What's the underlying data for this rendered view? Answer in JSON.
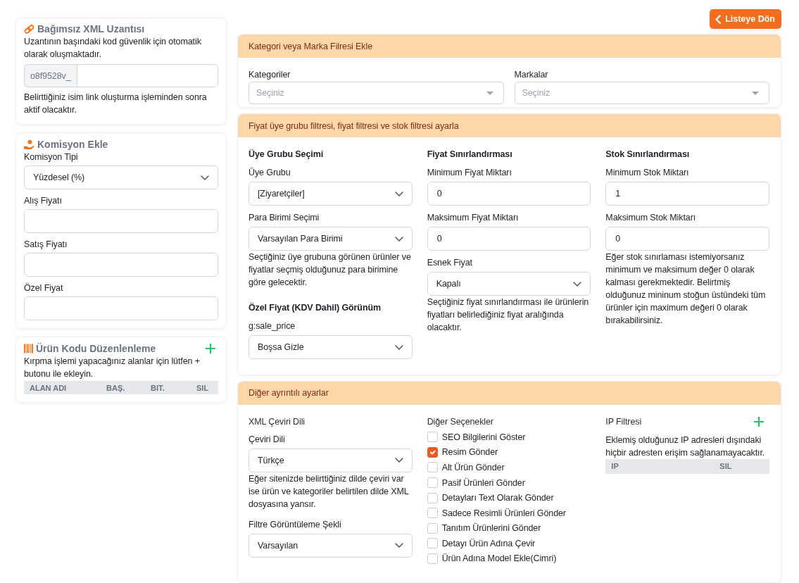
{
  "sidebar": [
    {
      "kind": "xml_extension",
      "title": "Bağımsız XML Uzantısı",
      "description": "Uzantının başındaki kod güvenlik için otomatik olarak oluşmaktadır.",
      "prefix": "o8f9528v_",
      "note": "Belirttiğiniz isim link oluşturma işleminden sonra aktif olacaktır."
    },
    {
      "kind": "commission",
      "title": "Komisyon Ekle",
      "fields": [
        {
          "kind": "select",
          "label": "Komisyon Tipi",
          "value": "Yüzdesel (%)"
        },
        {
          "kind": "input",
          "label": "Alış Fiyatı"
        },
        {
          "kind": "input",
          "label": "Satış Fiyatı"
        },
        {
          "kind": "input",
          "label": "Özel Fiyat"
        }
      ]
    },
    {
      "kind": "product_code",
      "title": "Ürün Kodu Düzenlenleme",
      "add_button": true,
      "description": "Kırpma işlemi yapacağınız alanlar için lütfen + butonu ile ekleyin.",
      "columns": [
        "ALAN ADI",
        "BAŞ.",
        "BIT.",
        "SIL"
      ]
    }
  ],
  "back_button": {
    "label": "Listeye Dön"
  },
  "sections": [
    {
      "title": "Kategori veya Marka Filresi Ekle",
      "columns": [
        {
          "items": [
            {
              "kind": "combo",
              "label": "Kategoriler",
              "placeholder": "Seçiniz"
            }
          ]
        },
        {
          "items": [
            {
              "kind": "combo",
              "label": "Markalar",
              "placeholder": "Seçiniz"
            }
          ]
        }
      ]
    },
    {
      "title": "Fiyat üye grubu filtresi, fiyat filtresi ve stok filtresi ayarla",
      "columns": [
        {
          "items": [
            {
              "kind": "heading",
              "text": "Üye Grubu Seçimi"
            },
            {
              "kind": "select",
              "label": "Üye Grubu",
              "value": "[Ziyaretçiler]"
            },
            {
              "kind": "select",
              "label": "Para Birimi Seçimi",
              "value": "Varsayılan Para Birimi"
            },
            {
              "kind": "help",
              "text": "Seçtiğiniz üye grubuna görünen ürünler ve fiyatlar seçmiş olduğunuz para birimine göre gelecektir."
            },
            {
              "kind": "heading",
              "text": "Özel Fiyat (KDV Dahil) Görünüm"
            },
            {
              "kind": "select",
              "label": "g:sale_price",
              "value": "Boşsa Gizle"
            }
          ]
        },
        {
          "items": [
            {
              "kind": "heading",
              "text": "Fiyat Sınırlandırması"
            },
            {
              "kind": "input",
              "label": "Minimum Fiyat Miktarı",
              "value": "0"
            },
            {
              "kind": "input",
              "label": "Maksimum Fiyat Miktarı",
              "value": "0"
            },
            {
              "kind": "select",
              "label": "Esnek Fiyat",
              "value": "Kapalı"
            },
            {
              "kind": "help",
              "text": "Seçtiğiniz fiyat sınırlandırması ile ürünlerin fiyatları belirlediğiniz fiyat aralığında olacaktır."
            }
          ]
        },
        {
          "items": [
            {
              "kind": "heading",
              "text": "Stok Sınırlandırması"
            },
            {
              "kind": "input",
              "label": "Minimum Stok Miktarı",
              "value": "1"
            },
            {
              "kind": "input",
              "label": "Maksimum Stok Miktarı",
              "value": "0"
            },
            {
              "kind": "help",
              "text": "Eğer stok sınırlaması istemiyorsanız minimum ve maksimum değer 0 olarak kalması gerekmektedir. Belirtmiş olduğunuz mininum stoğun üstündeki tüm ürünler için maximum değeri 0 olarak bırakabilirsiniz."
            }
          ]
        }
      ]
    },
    {
      "title": "Diğer ayrıntılı ayarlar",
      "columns": [
        {
          "items": [
            {
              "kind": "caption",
              "text": "XML Çeviri Dili"
            },
            {
              "kind": "select",
              "label": "Çeviri Dili",
              "value": "Türkçe"
            },
            {
              "kind": "help",
              "text": "Eğer sitenizde belirttiğiniz dilde çeviri var ise ürün ve kategoriler belirtilen dilde XML dosyasına yansır."
            },
            {
              "kind": "select",
              "label": "Filtre Görüntüleme Şekli",
              "value": "Varsayılan"
            }
          ]
        },
        {
          "items": [
            {
              "kind": "caption",
              "text": "Diğer Seçenekler"
            },
            {
              "kind": "checkbox",
              "label": "SEO Bilgilerini Göster",
              "checked": false
            },
            {
              "kind": "checkbox",
              "label": "Resim Gönder",
              "checked": true
            },
            {
              "kind": "checkbox",
              "label": "Alt Ürün Gönder",
              "checked": false
            },
            {
              "kind": "checkbox",
              "label": "Pasif Ürünleri Gönder",
              "checked": false
            },
            {
              "kind": "checkbox",
              "label": "Detayları Text Olarak Gönder",
              "checked": false
            },
            {
              "kind": "checkbox",
              "label": "Sadece Resimli Ürünleri Gönder",
              "checked": false
            },
            {
              "kind": "checkbox",
              "label": "Tanıtım Ürünlerini Gönder",
              "checked": false
            },
            {
              "kind": "checkbox",
              "label": "Detayı Ürün Adına Çevir",
              "checked": false
            },
            {
              "kind": "checkbox",
              "label": "Ürün Adına Model Ekle(Cimri)",
              "checked": false
            }
          ]
        },
        {
          "items": [
            {
              "kind": "caption",
              "text": "IP Filtresi",
              "add_button": true
            },
            {
              "kind": "help",
              "text": "Eklemiş olduğunuz IP adresleri dışındaki hiçbir adresten erişim sağlanamayacaktır."
            },
            {
              "kind": "table",
              "columns": [
                "IP",
                "SIL"
              ]
            }
          ]
        }
      ]
    }
  ]
}
